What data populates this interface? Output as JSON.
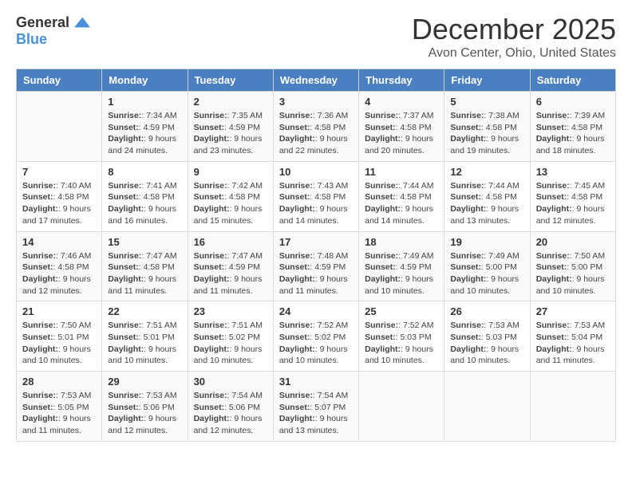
{
  "logo": {
    "general": "General",
    "blue": "Blue"
  },
  "title": "December 2025",
  "location": "Avon Center, Ohio, United States",
  "days_of_week": [
    "Sunday",
    "Monday",
    "Tuesday",
    "Wednesday",
    "Thursday",
    "Friday",
    "Saturday"
  ],
  "weeks": [
    [
      {
        "day": "",
        "info": ""
      },
      {
        "day": "1",
        "info": "Sunrise: 7:34 AM\nSunset: 4:59 PM\nDaylight: 9 hours and 24 minutes."
      },
      {
        "day": "2",
        "info": "Sunrise: 7:35 AM\nSunset: 4:59 PM\nDaylight: 9 hours and 23 minutes."
      },
      {
        "day": "3",
        "info": "Sunrise: 7:36 AM\nSunset: 4:58 PM\nDaylight: 9 hours and 22 minutes."
      },
      {
        "day": "4",
        "info": "Sunrise: 7:37 AM\nSunset: 4:58 PM\nDaylight: 9 hours and 20 minutes."
      },
      {
        "day": "5",
        "info": "Sunrise: 7:38 AM\nSunset: 4:58 PM\nDaylight: 9 hours and 19 minutes."
      },
      {
        "day": "6",
        "info": "Sunrise: 7:39 AM\nSunset: 4:58 PM\nDaylight: 9 hours and 18 minutes."
      }
    ],
    [
      {
        "day": "7",
        "info": "Sunrise: 7:40 AM\nSunset: 4:58 PM\nDaylight: 9 hours and 17 minutes."
      },
      {
        "day": "8",
        "info": "Sunrise: 7:41 AM\nSunset: 4:58 PM\nDaylight: 9 hours and 16 minutes."
      },
      {
        "day": "9",
        "info": "Sunrise: 7:42 AM\nSunset: 4:58 PM\nDaylight: 9 hours and 15 minutes."
      },
      {
        "day": "10",
        "info": "Sunrise: 7:43 AM\nSunset: 4:58 PM\nDaylight: 9 hours and 14 minutes."
      },
      {
        "day": "11",
        "info": "Sunrise: 7:44 AM\nSunset: 4:58 PM\nDaylight: 9 hours and 14 minutes."
      },
      {
        "day": "12",
        "info": "Sunrise: 7:44 AM\nSunset: 4:58 PM\nDaylight: 9 hours and 13 minutes."
      },
      {
        "day": "13",
        "info": "Sunrise: 7:45 AM\nSunset: 4:58 PM\nDaylight: 9 hours and 12 minutes."
      }
    ],
    [
      {
        "day": "14",
        "info": "Sunrise: 7:46 AM\nSunset: 4:58 PM\nDaylight: 9 hours and 12 minutes."
      },
      {
        "day": "15",
        "info": "Sunrise: 7:47 AM\nSunset: 4:58 PM\nDaylight: 9 hours and 11 minutes."
      },
      {
        "day": "16",
        "info": "Sunrise: 7:47 AM\nSunset: 4:59 PM\nDaylight: 9 hours and 11 minutes."
      },
      {
        "day": "17",
        "info": "Sunrise: 7:48 AM\nSunset: 4:59 PM\nDaylight: 9 hours and 11 minutes."
      },
      {
        "day": "18",
        "info": "Sunrise: 7:49 AM\nSunset: 4:59 PM\nDaylight: 9 hours and 10 minutes."
      },
      {
        "day": "19",
        "info": "Sunrise: 7:49 AM\nSunset: 5:00 PM\nDaylight: 9 hours and 10 minutes."
      },
      {
        "day": "20",
        "info": "Sunrise: 7:50 AM\nSunset: 5:00 PM\nDaylight: 9 hours and 10 minutes."
      }
    ],
    [
      {
        "day": "21",
        "info": "Sunrise: 7:50 AM\nSunset: 5:01 PM\nDaylight: 9 hours and 10 minutes."
      },
      {
        "day": "22",
        "info": "Sunrise: 7:51 AM\nSunset: 5:01 PM\nDaylight: 9 hours and 10 minutes."
      },
      {
        "day": "23",
        "info": "Sunrise: 7:51 AM\nSunset: 5:02 PM\nDaylight: 9 hours and 10 minutes."
      },
      {
        "day": "24",
        "info": "Sunrise: 7:52 AM\nSunset: 5:02 PM\nDaylight: 9 hours and 10 minutes."
      },
      {
        "day": "25",
        "info": "Sunrise: 7:52 AM\nSunset: 5:03 PM\nDaylight: 9 hours and 10 minutes."
      },
      {
        "day": "26",
        "info": "Sunrise: 7:53 AM\nSunset: 5:03 PM\nDaylight: 9 hours and 10 minutes."
      },
      {
        "day": "27",
        "info": "Sunrise: 7:53 AM\nSunset: 5:04 PM\nDaylight: 9 hours and 11 minutes."
      }
    ],
    [
      {
        "day": "28",
        "info": "Sunrise: 7:53 AM\nSunset: 5:05 PM\nDaylight: 9 hours and 11 minutes."
      },
      {
        "day": "29",
        "info": "Sunrise: 7:53 AM\nSunset: 5:06 PM\nDaylight: 9 hours and 12 minutes."
      },
      {
        "day": "30",
        "info": "Sunrise: 7:54 AM\nSunset: 5:06 PM\nDaylight: 9 hours and 12 minutes."
      },
      {
        "day": "31",
        "info": "Sunrise: 7:54 AM\nSunset: 5:07 PM\nDaylight: 9 hours and 13 minutes."
      },
      {
        "day": "",
        "info": ""
      },
      {
        "day": "",
        "info": ""
      },
      {
        "day": "",
        "info": ""
      }
    ]
  ]
}
